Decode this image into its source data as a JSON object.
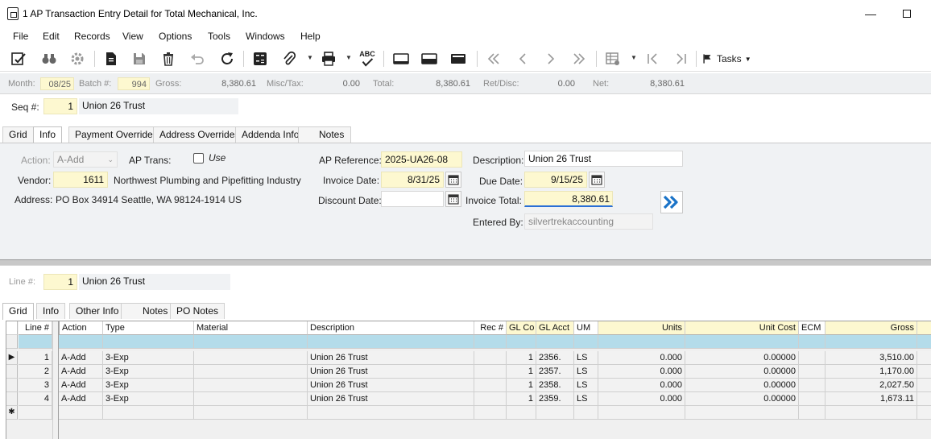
{
  "window": {
    "title": "1 AP Transaction Entry Detail for Total Mechanical, Inc.",
    "minimize_glyph": "—",
    "close_glyph": "✕"
  },
  "menu": [
    "File",
    "Edit",
    "Records",
    "View",
    "Options",
    "Tools",
    "Windows",
    "Help"
  ],
  "toolbar": {
    "tasks_label": "Tasks",
    "icons": [
      "edit-icon",
      "find-icon",
      "settings-icon",
      "document-icon",
      "save-icon",
      "delete-icon",
      "undo-icon",
      "refresh-icon",
      "calculator-icon",
      "attach-icon",
      "print-icon",
      "spellcheck-icon",
      "layout-1-icon",
      "layout-2-icon",
      "layout-3-icon",
      "first-icon",
      "prev-icon",
      "next-icon",
      "last-icon",
      "grid-icon",
      "start-icon",
      "end-icon",
      "flag-icon"
    ],
    "spellcheck_text": "ABC"
  },
  "batch": {
    "month_label": "Month:",
    "month": "08/25",
    "batch_label": "Batch #:",
    "batch": "994",
    "gross_label": "Gross:",
    "gross": "8,380.61",
    "misc_label": "Misc/Tax:",
    "misc": "0.00",
    "total_label": "Total:",
    "total": "8,380.61",
    "ret_label": "Ret/Disc:",
    "ret": "0.00",
    "net_label": "Net:",
    "net": "8,380.61"
  },
  "header": {
    "seq_label": "Seq #:",
    "seq": "1",
    "seq_desc": "Union 26 Trust"
  },
  "header_tabs": [
    "Grid",
    "Info",
    "Payment Overrides",
    "Address Overrides",
    "Addenda Info",
    "Notes"
  ],
  "info": {
    "action_label": "Action:",
    "action": "A-Add",
    "ap_trans_label": "AP Trans:",
    "use_label": "Use",
    "vendor_label": "Vendor:",
    "vendor": "1611",
    "vendor_name": "Northwest Plumbing and Pipefitting Industry",
    "address_label": "Address:",
    "address": "PO Box 34914  Seattle, WA  98124-1914  US",
    "ap_ref_label": "AP Reference:",
    "ap_ref": "2025-UA26-08",
    "invoice_date_label": "Invoice Date:",
    "invoice_date": "8/31/25",
    "discount_date_label": "Discount Date:",
    "discount_date": "",
    "description_label": "Description:",
    "description": "Union 26 Trust",
    "due_date_label": "Due Date:",
    "due_date": "9/15/25",
    "invoice_total_label": "Invoice Total:",
    "invoice_total": "8,380.61",
    "entered_by_label": "Entered By:",
    "entered_by": "silvertrekaccounting"
  },
  "line": {
    "line_label": "Line #:",
    "line": "1",
    "line_desc": "Union 26 Trust"
  },
  "line_tabs": [
    "Grid",
    "Info",
    "Other Info",
    "Notes",
    "PO Notes"
  ],
  "grid": {
    "columns": [
      "Line #",
      "Action",
      "Type",
      "Material",
      "Description",
      "Rec #",
      "GL Co",
      "GL Acct",
      "UM",
      "Units",
      "Unit Cost",
      "ECM",
      "Gross"
    ],
    "rows": [
      [
        "1",
        "A-Add",
        "3-Exp",
        "",
        "Union 26 Trust",
        "",
        "1",
        "2356.",
        "LS",
        "0.000",
        "0.00000",
        "",
        "3,510.00"
      ],
      [
        "2",
        "A-Add",
        "3-Exp",
        "",
        "Union 26 Trust",
        "",
        "1",
        "2357.",
        "LS",
        "0.000",
        "0.00000",
        "",
        "1,170.00"
      ],
      [
        "3",
        "A-Add",
        "3-Exp",
        "",
        "Union 26 Trust",
        "",
        "1",
        "2358.",
        "LS",
        "0.000",
        "0.00000",
        "",
        "2,027.50"
      ],
      [
        "4",
        "A-Add",
        "3-Exp",
        "",
        "Union 26 Trust",
        "",
        "1",
        "2359.",
        "LS",
        "0.000",
        "0.00000",
        "",
        "1,673.11"
      ]
    ],
    "current_row_marker": "▶",
    "new_row_marker": "✱"
  },
  "colors": {
    "yellow_field": "#fdf8d0",
    "filter_row": "#b4dcea",
    "accent_blue": "#1a73c8"
  }
}
